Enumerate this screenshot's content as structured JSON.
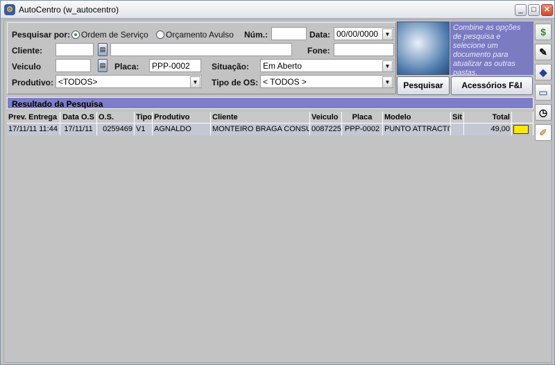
{
  "window": {
    "title": "AutoCentro (w_autocentro)"
  },
  "form": {
    "pesquisar_por": "Pesquisar por:",
    "radio_os": "Ordem de Serviço",
    "radio_orc": "Orçamento Avulso",
    "num_label": "Núm.:",
    "num_value": "",
    "data_label": "Data:",
    "data_value": "00/00/0000",
    "cliente_label": "Cliente:",
    "cliente_code": "",
    "cliente_name": "",
    "fone_label": "Fone:",
    "fone_value": "",
    "veiculo_label": "Veiculo",
    "veiculo_value": "",
    "placa_label": "Placa:",
    "placa_value": "PPP-0002",
    "situacao_label": "Situação:",
    "situacao_value": "Em Aberto",
    "produtivo_label": "Produtivo:",
    "produtivo_value": "<TODOS>",
    "tipo_os_label": "Tipo de OS:",
    "tipo_os_value": "< TODOS >"
  },
  "info_text": "Combine as opções de pesquisa e selecione um documento para atualizar as outras pastas.",
  "buttons": {
    "pesquisar": "Pesquisar",
    "acessorios": "Acessórios F&I"
  },
  "results": {
    "title": "Resultado da Pesquisa",
    "columns": [
      "Prev. Entrega",
      "Data O.S",
      "O.S.",
      "Tipo",
      "Produtivo",
      "Cliente",
      "Veiculo",
      "Placa",
      "Modelo",
      "Sit",
      "Total"
    ],
    "rows": [
      [
        "17/11/11 11:44",
        "17/11/11",
        "0259469",
        "V1",
        "AGNALDO",
        "MONTEIRO BRAGA CONSULT",
        "0087225",
        "PPP-0002",
        "PUNTO ATTRACTIVE",
        "",
        "49,00"
      ]
    ]
  },
  "sidebar_icons": [
    "dollar-icon",
    "edit-document-icon",
    "shapes-icon",
    "printer-icon",
    "clock-icon",
    "tools-icon"
  ]
}
